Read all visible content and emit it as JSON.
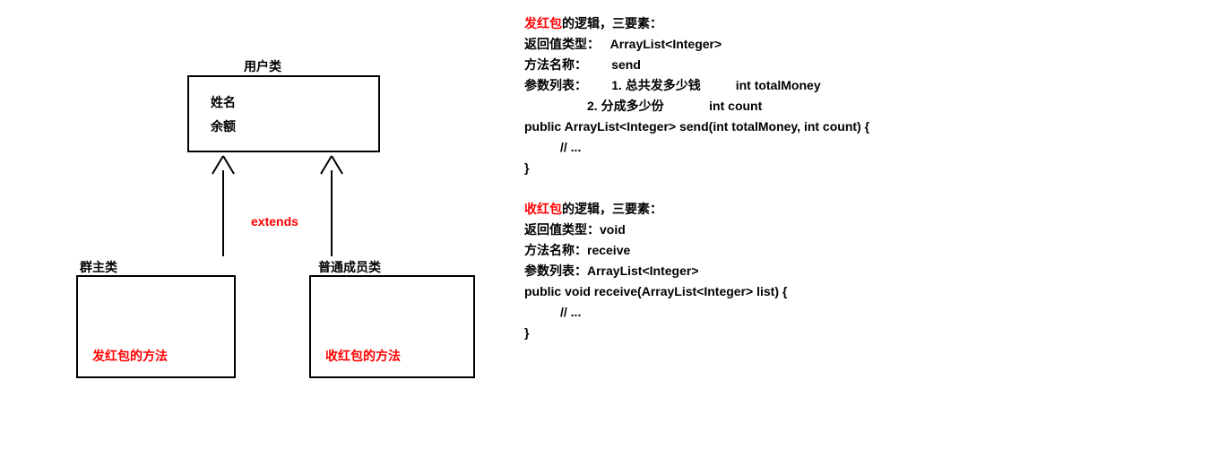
{
  "diagram": {
    "userClass": {
      "title": "用户类",
      "field1": "姓名",
      "field2": "余额"
    },
    "ownerClass": {
      "title": "群主类",
      "method": "发红包的方法"
    },
    "memberClass": {
      "title": "普通成员类",
      "method": "收红包的方法"
    },
    "extendsLabel": "extends"
  },
  "send": {
    "title_red": "发红包",
    "title_rest": "的逻辑，三要素：",
    "return_label": "返回值类型：",
    "return_value": "ArrayList<Integer>",
    "method_label": "方法名称：",
    "method_value": "send",
    "param_label": "参数列表：",
    "param1_desc": "1. 总共发多少钱",
    "param1_type": "int totalMoney",
    "param2_desc": "2. 分成多少份",
    "param2_type": "int count",
    "sig": "public ArrayList<Integer> send(int totalMoney, int count) {",
    "body": "// ...",
    "close": "}"
  },
  "receive": {
    "title_red": "收红包",
    "title_rest": "的逻辑，三要素：",
    "return_label": "返回值类型：",
    "return_value": "void",
    "method_label": "方法名称：",
    "method_value": "receive",
    "param_label": "参数列表：",
    "param_value": "ArrayList<Integer>",
    "sig": "public void receive(ArrayList<Integer> list) {",
    "body": "// ...",
    "close": "}"
  }
}
